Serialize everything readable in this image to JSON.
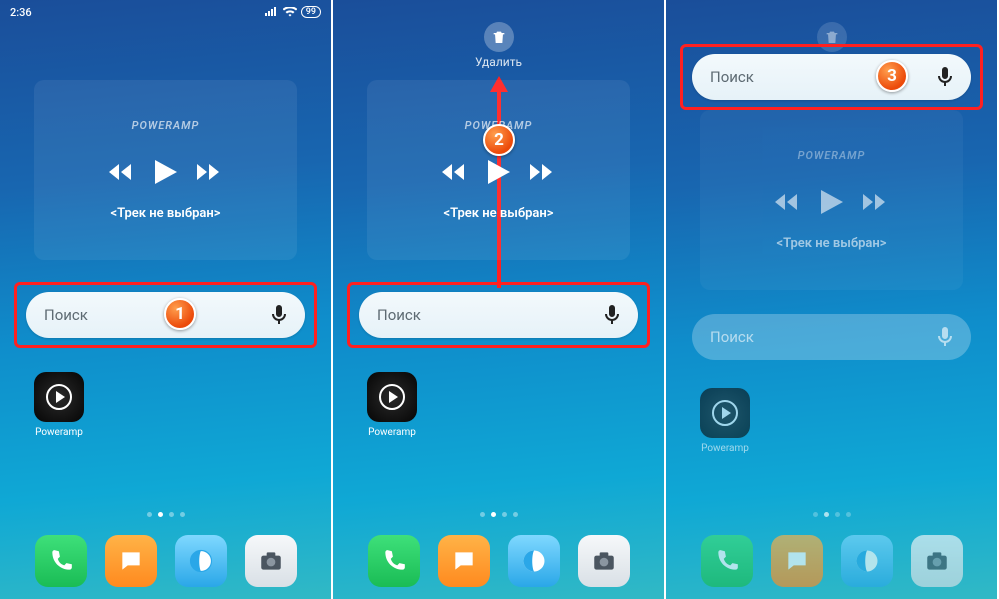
{
  "statusbar": {
    "time": "2:36",
    "battery": "99"
  },
  "delete": {
    "label": "Удалить"
  },
  "music": {
    "brand": "POWERAMP",
    "track": "<Трек не выбран>"
  },
  "search": {
    "placeholder": "Поиск"
  },
  "app": {
    "name": "Poweramp"
  },
  "steps": {
    "s1": "1",
    "s2": "2",
    "s3": "3"
  },
  "dock": {
    "phone": "phone",
    "messages": "messages",
    "browser": "browser",
    "camera": "camera"
  }
}
